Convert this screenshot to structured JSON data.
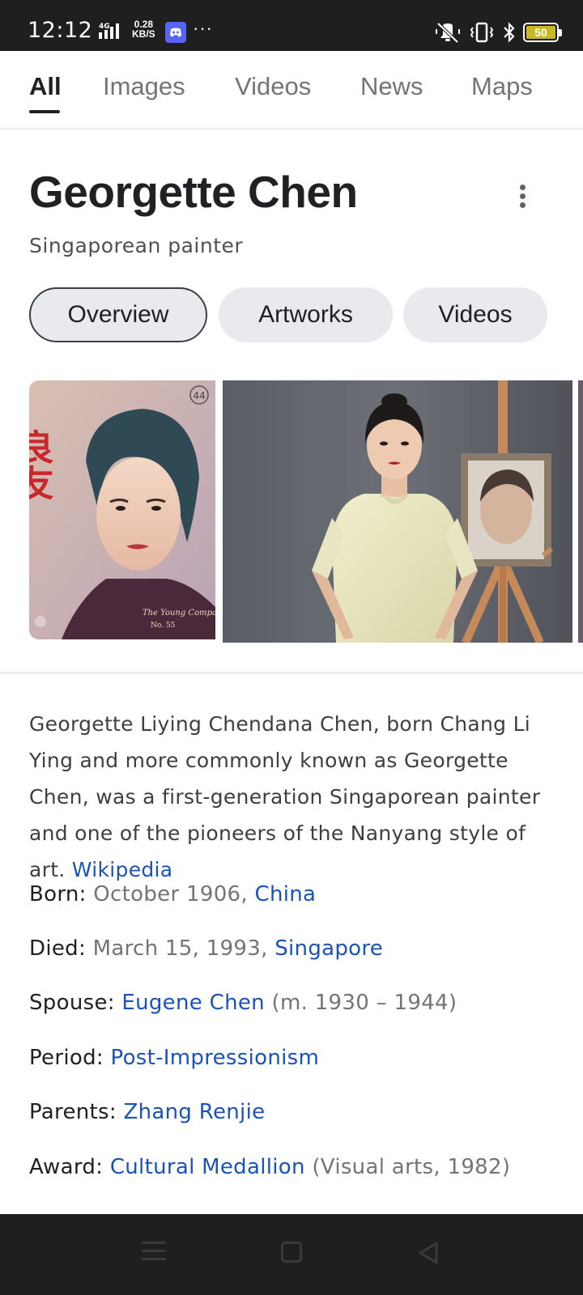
{
  "status": {
    "time": "12:12",
    "net_label": "4G",
    "speed_value": "0.28",
    "speed_unit": "KB/S",
    "more": "···",
    "battery": "50"
  },
  "tabs": [
    {
      "label": "All",
      "active": true
    },
    {
      "label": "Images"
    },
    {
      "label": "Videos"
    },
    {
      "label": "News"
    },
    {
      "label": "Maps"
    }
  ],
  "panel": {
    "title": "Georgette Chen",
    "subtitle": "Singaporean painter",
    "chips": [
      {
        "label": "Overview",
        "selected": true
      },
      {
        "label": "Artworks"
      },
      {
        "label": "Videos"
      }
    ]
  },
  "description": {
    "text": "Georgette Liying Chendana Chen, born Chang Li Ying and more commonly known as Georgette Chen, was a first-generation Singaporean painter and one of the pioneers of the Nanyang style of art. ",
    "source": "Wikipedia"
  },
  "facts": {
    "born": {
      "label": "Born:",
      "value": "October 1906, ",
      "link": "China"
    },
    "died": {
      "label": "Died:",
      "value": "March 15, 1993, ",
      "link": "Singapore"
    },
    "spouse": {
      "label": "Spouse:",
      "link": "Eugene Chen",
      "value": "(m. 1930 – 1944)"
    },
    "period": {
      "label": "Period:",
      "link": "Post-Impressionism"
    },
    "parents": {
      "label": "Parents:",
      "link": "Zhang Renjie"
    },
    "award": {
      "label": "Award:",
      "link": "Cultural Medallion",
      "value": "(Visual arts, 1982)"
    }
  },
  "images": {
    "poster_chars": "良友",
    "poster_caption": "The Young Companion",
    "poster_number": "No. 55",
    "poster_badge": "44"
  }
}
